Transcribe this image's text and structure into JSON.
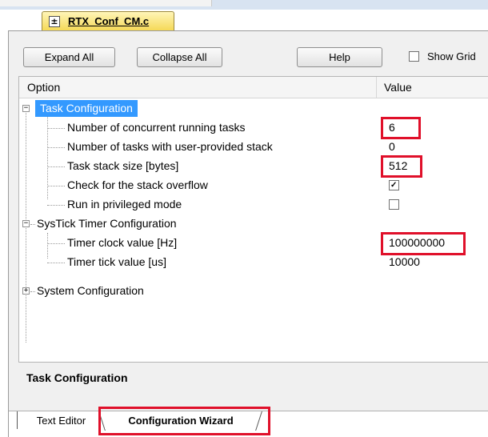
{
  "file_tab": {
    "label": "RTX_Conf_CM.c",
    "icon": "c-file-icon"
  },
  "toolbar": {
    "expand_label": "Expand All",
    "collapse_label": "Collapse All",
    "help_label": "Help",
    "show_grid_label": "Show Grid",
    "show_grid_checked": false
  },
  "grid": {
    "columns": {
      "option": "Option",
      "value": "Value"
    },
    "rows": [
      {
        "label": "Task Configuration",
        "value": "",
        "level": 0,
        "expander": "−",
        "selected": true
      },
      {
        "label": "Number of concurrent running tasks",
        "value": "6",
        "level": 1,
        "highlighted": true
      },
      {
        "label": "Number of tasks with user-provided stack",
        "value": "0",
        "level": 1
      },
      {
        "label": "Task stack size [bytes]",
        "value": "512",
        "level": 1,
        "highlighted": true
      },
      {
        "label": "Check for the stack overflow",
        "value": "",
        "checkbox": true,
        "checked": true,
        "level": 1
      },
      {
        "label": "Run in privileged mode",
        "value": "",
        "checkbox": true,
        "checked": false,
        "level": 1
      },
      {
        "label": "SysTick Timer Configuration",
        "value": "",
        "level": 0,
        "expander": "−"
      },
      {
        "label": "Timer clock value [Hz]",
        "value": "100000000",
        "level": 1,
        "highlighted": true
      },
      {
        "label": "Timer tick value [us]",
        "value": "10000",
        "level": 1
      },
      {
        "label": "System Configuration",
        "value": "",
        "level": 0,
        "expander": "+"
      }
    ]
  },
  "description": {
    "title": "Task Configuration"
  },
  "bottom_tabs": {
    "text_editor": "Text Editor",
    "config_wizard": "Configuration Wizard",
    "active": "config_wizard"
  },
  "colors": {
    "selection": "#3399ff",
    "highlight_box": "#e0102a",
    "file_tab": "#f5d958"
  }
}
